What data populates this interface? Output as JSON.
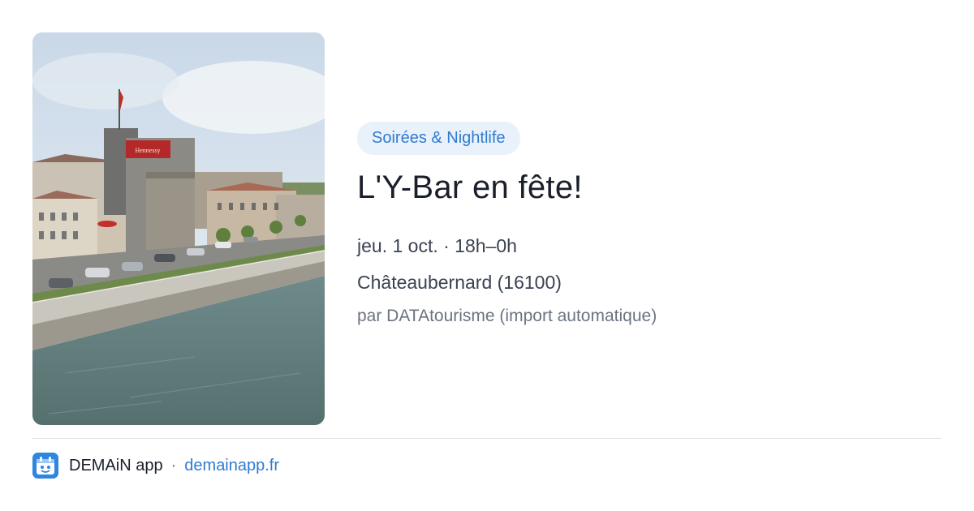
{
  "event": {
    "category": "Soirées & Nightlife",
    "title": "L'Y-Bar en fête!",
    "date": "jeu. 1 oct. · 18h–0h",
    "location": "Châteaubernard (16100)",
    "source": "par DATAtourisme (import automatique)",
    "image": "photo-riverside-town-with-distillery-buildings",
    "sign_text": "Hennessy"
  },
  "footer": {
    "app_name": "DEMAiN app",
    "separator": "·",
    "link": "demainapp.fr",
    "icon": "demain-app-icon"
  },
  "colors": {
    "accent": "#2f7bd0",
    "chip_bg": "#e9f1fb",
    "title": "#1a1f2b",
    "muted": "#6b7382",
    "divider": "#dde3ea"
  }
}
